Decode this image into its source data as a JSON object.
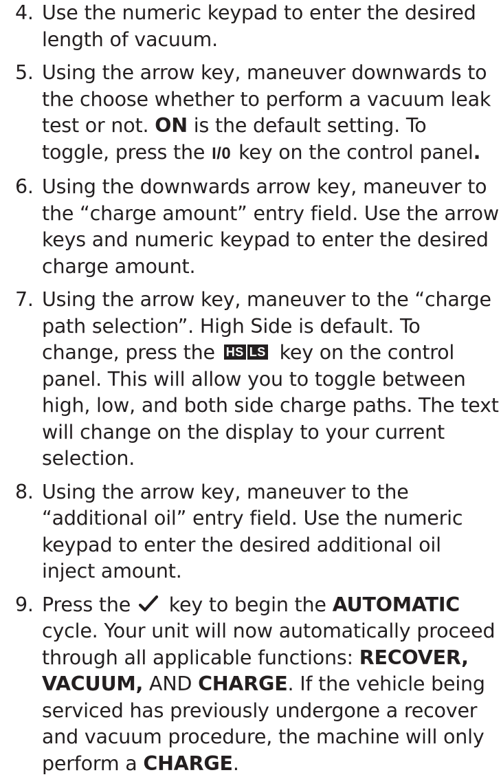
{
  "colors": {
    "text": "#231f20",
    "key_bg": "#231f20",
    "key_text": "#ffffff"
  },
  "steps": [
    {
      "num": "4.",
      "text": "Use the numeric keypad to enter the desired length of vacuum."
    },
    {
      "num": "5.",
      "t1": "Using the arrow key, maneuver downwards to the choose whether to perform a vacuum leak test or not. ",
      "b1": "ON",
      "t2": " is the default setting. To toggle, press the ",
      "key": "I/0",
      "t3": " key on the control panel",
      "b2": "."
    },
    {
      "num": "6.",
      "text": "Using the downwards arrow key, maneuver to the “charge amount” entry field. Use the arrow keys and numeric keypad to enter the desired charge amount."
    },
    {
      "num": "7.",
      "t1": "Using the arrow key, maneuver to the “charge path selection”. High Side is default. To change, press the ",
      "key_hs": "HS",
      "key_ls": "LS",
      "t2": " key on the control panel. This will allow you to toggle between high, low, and both side charge paths. The text will change on the display to your current selection."
    },
    {
      "num": "8.",
      "text": "Using the arrow key, maneuver to the “additional oil” entry field. Use the numeric keypad to enter the desired additional oil inject amount."
    },
    {
      "num": "9.",
      "t1": "Press the ",
      "icon": "checkmark-icon",
      "t2": " key to begin the ",
      "b1": "AUTOMATIC",
      "t3": " cycle. Your unit will now automatically proceed through all applicable functions: ",
      "b2": "RECOVER, VACUUM,",
      "t4": " AND ",
      "b3": "CHARGE",
      "t5": ". If the vehicle being serviced has previously undergone a recover and vacuum procedure, the machine will only perform a ",
      "b4": "CHARGE",
      "t6": "."
    }
  ]
}
